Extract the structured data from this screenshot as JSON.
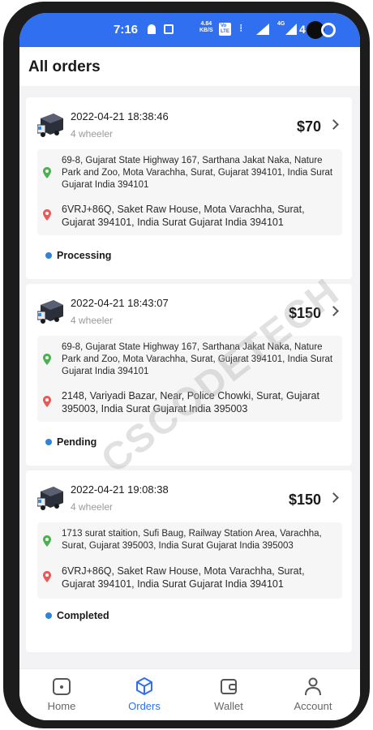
{
  "status_bar": {
    "time": "7:16",
    "speed_value": "4.84",
    "speed_unit": "KB/S",
    "volte": "Vo\nLTE",
    "network": "4G",
    "battery": "4"
  },
  "header": {
    "title": "All orders"
  },
  "orders": [
    {
      "datetime": "2022-04-21 18:38:46",
      "vehicle": "4 wheeler",
      "price": "$70",
      "pickup": "69-8, Gujarat State Highway 167, Sarthana Jakat Naka, Nature Park and Zoo, Mota Varachha, Surat, Gujarat 394101, India Surat Gujarat India 394101",
      "drop": "6VRJ+86Q, Saket Raw House, Mota Varachha, Surat, Gujarat 394101, India Surat Gujarat India 394101",
      "status": "Processing"
    },
    {
      "datetime": "2022-04-21 18:43:07",
      "vehicle": "4 wheeler",
      "price": "$150",
      "pickup": "69-8, Gujarat State Highway 167, Sarthana Jakat Naka, Nature Park and Zoo, Mota Varachha, Surat, Gujarat 394101, India Surat Gujarat India 394101",
      "drop": "2148, Variyadi Bazar, Near, Police Chowki, Surat, Gujarat 395003, India Surat Gujarat India 395003",
      "status": "Pending"
    },
    {
      "datetime": "2022-04-21 19:08:38",
      "vehicle": "4 wheeler",
      "price": "$150",
      "pickup": "1713 surat staition, Sufi Baug, Railway Station Area, Varachha, Surat, Gujarat 395003, India Surat Gujarat India 395003",
      "drop": "6VRJ+86Q, Saket Raw House, Mota Varachha, Surat, Gujarat 394101, India Surat Gujarat India 394101",
      "status": "Completed"
    }
  ],
  "watermark": "CSCODETECH",
  "nav": [
    {
      "label": "Home",
      "icon": "home-icon"
    },
    {
      "label": "Orders",
      "icon": "box-icon",
      "active": true
    },
    {
      "label": "Wallet",
      "icon": "wallet-icon"
    },
    {
      "label": "Account",
      "icon": "person-icon"
    }
  ],
  "colors": {
    "accent": "#2f6ff0",
    "pickup_pin": "#4caf50",
    "drop_pin": "#e85a5a",
    "status_dot": "#2f84d8"
  }
}
